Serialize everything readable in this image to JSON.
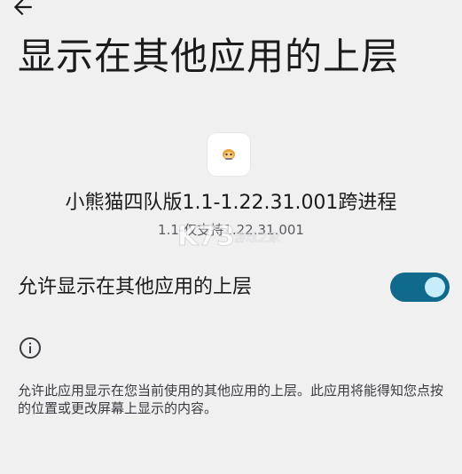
{
  "header": {
    "back_icon": "arrow-left-icon",
    "title": "显示在其他应用的上层"
  },
  "app": {
    "icon": "panda-app-icon",
    "name": "小熊猫四队版1.1-1.22.31.001跨进程",
    "version": "1.1-仅支持1.22.31.001"
  },
  "watermark": {
    "text": "K73",
    "subtext": "游戏之家"
  },
  "setting": {
    "label": "允许显示在其他应用的上层",
    "enabled": true,
    "accent_color": "#0f6a8c"
  },
  "info": {
    "icon": "info-icon",
    "description": "允许此应用显示在您当前使用的其他应用的上层。此应用将能得知您点按的位置或更改屏幕上显示的内容。"
  }
}
